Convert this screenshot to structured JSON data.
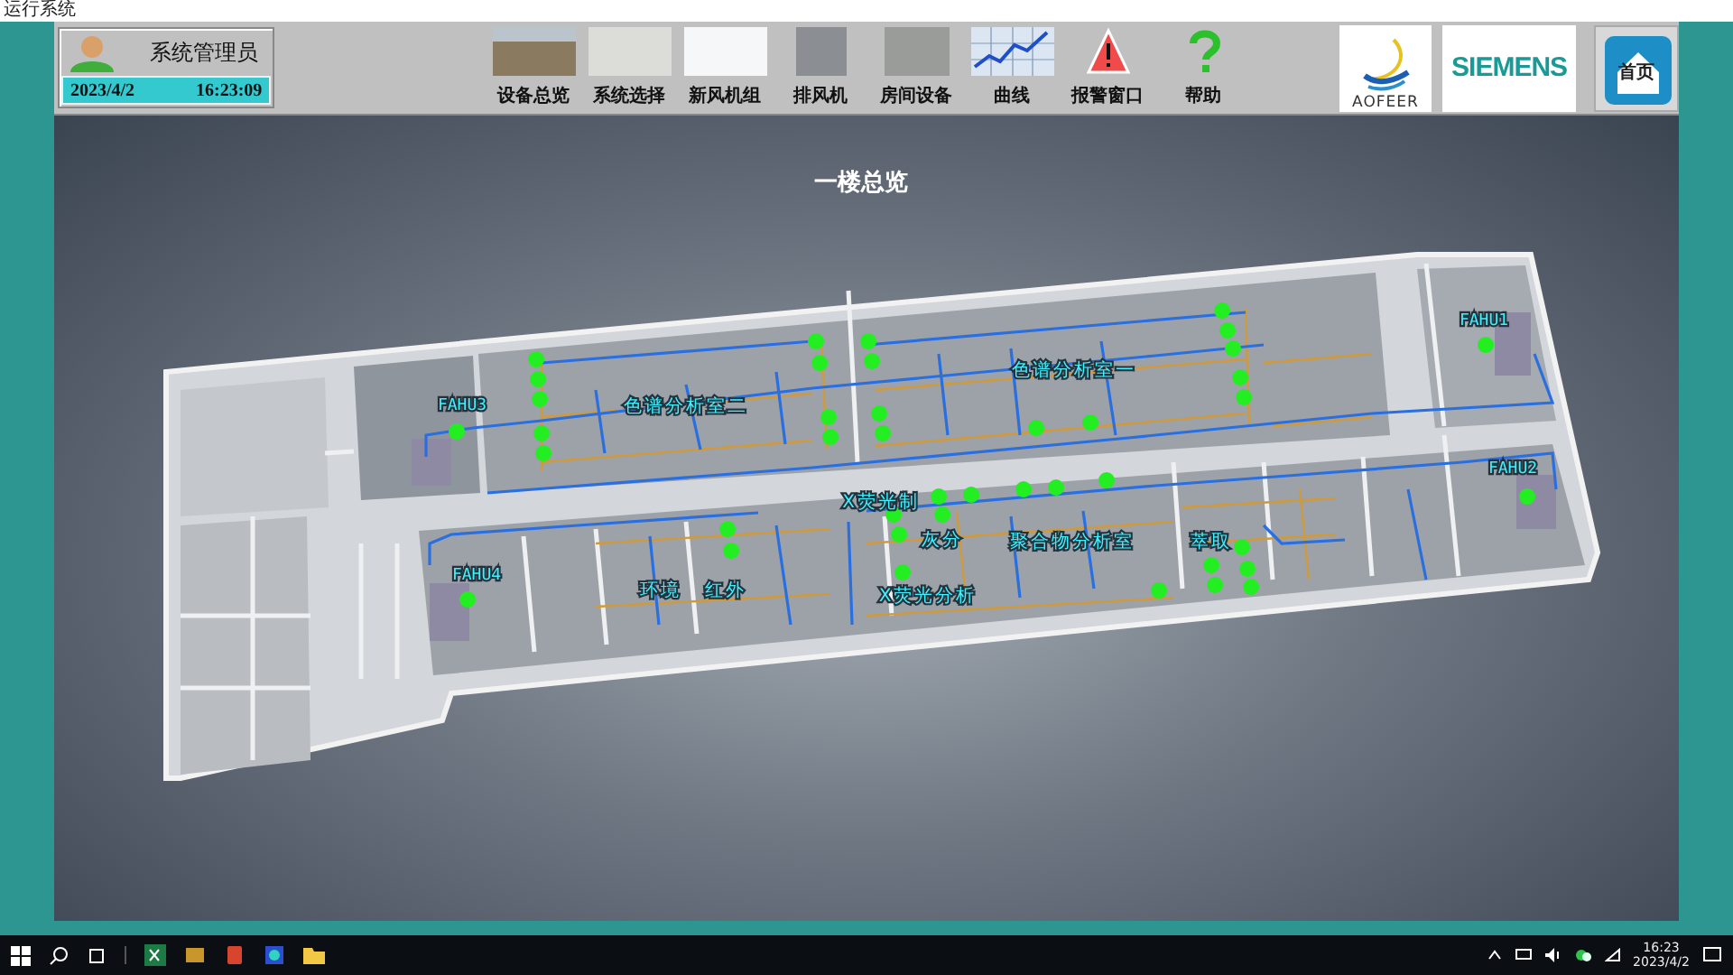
{
  "window": {
    "title": "运行系统"
  },
  "user": {
    "name": "系统管理员",
    "date": "2023/4/2",
    "time": "16:23:09"
  },
  "nav": [
    {
      "label": "设备总览"
    },
    {
      "label": "系统选择"
    },
    {
      "label": "新风机组"
    },
    {
      "label": "排风机"
    },
    {
      "label": "房间设备"
    },
    {
      "label": "曲线"
    },
    {
      "label": "报警窗口"
    },
    {
      "label": "帮助"
    }
  ],
  "logos": {
    "brand_1": "AOFEER",
    "brand_2": "SIEMENS"
  },
  "home_button": {
    "label": "首页"
  },
  "plan": {
    "title": "一楼总览",
    "units": [
      "FAHU1",
      "FAHU2",
      "FAHU3",
      "FAHU4"
    ],
    "rooms": [
      "色谱分析室二",
      "色谱分析室一",
      "X荧光制",
      "灰分",
      "聚合物分析室",
      "萃取",
      "环境",
      "红外",
      "X荧光分析"
    ]
  },
  "taskbar": {
    "time": "16:23",
    "date": "2023/4/2"
  }
}
